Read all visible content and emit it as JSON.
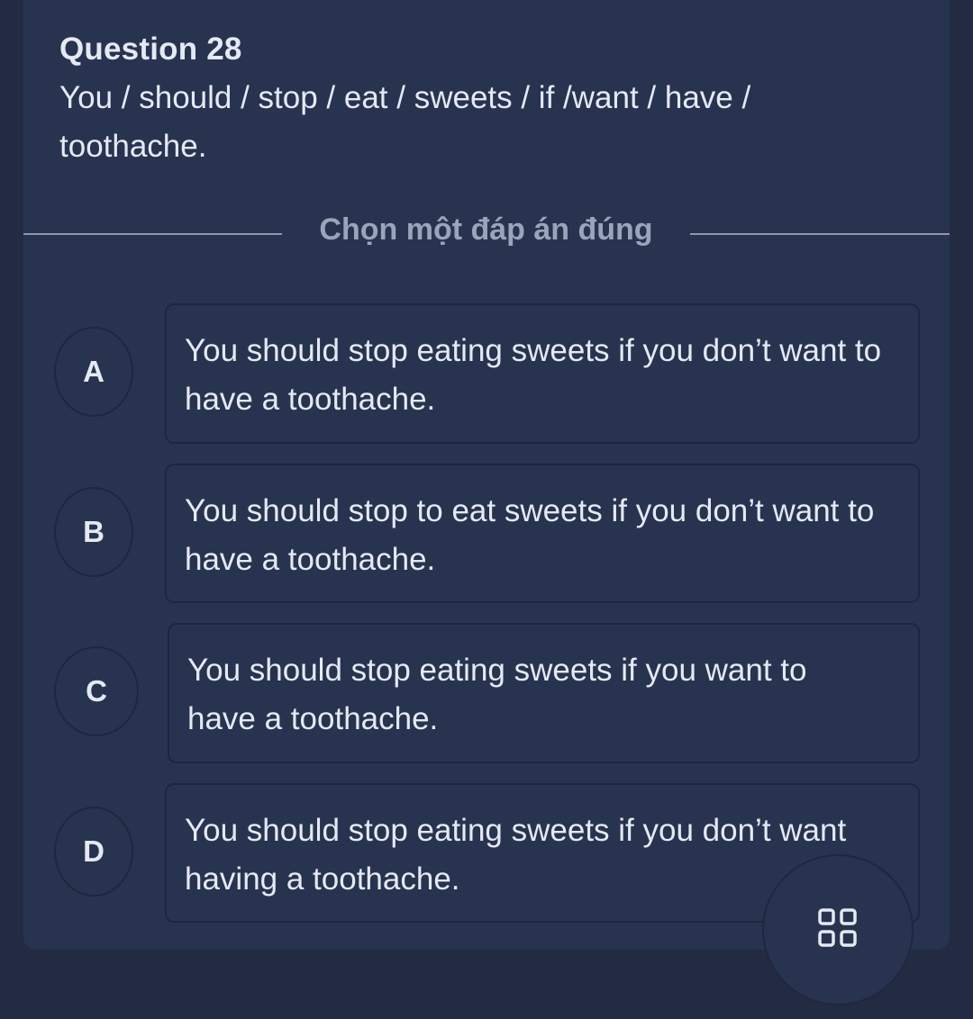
{
  "question": {
    "number_label": "Question 28",
    "prompt": "You / should / stop / eat / sweets / if /want / have / toothache."
  },
  "instruction": "Chọn một đáp án đúng",
  "options": [
    {
      "letter": "A",
      "text": "You should stop eating sweets if you don’t want to have a toothache."
    },
    {
      "letter": "B",
      "text": "You should stop to eat sweets if you don’t want to have a toothache."
    },
    {
      "letter": "C",
      "text": "You should stop eating sweets if you want to have a toothache."
    },
    {
      "letter": "D",
      "text": "You should stop eating sweets if you don’t want having a toothache."
    }
  ],
  "fab": {
    "icon": "grid-icon"
  },
  "colors": {
    "background": "#222b42",
    "card": "#283350",
    "border": "#1e2740",
    "text": "#e4e9f3",
    "muted": "#9ba4b9"
  }
}
